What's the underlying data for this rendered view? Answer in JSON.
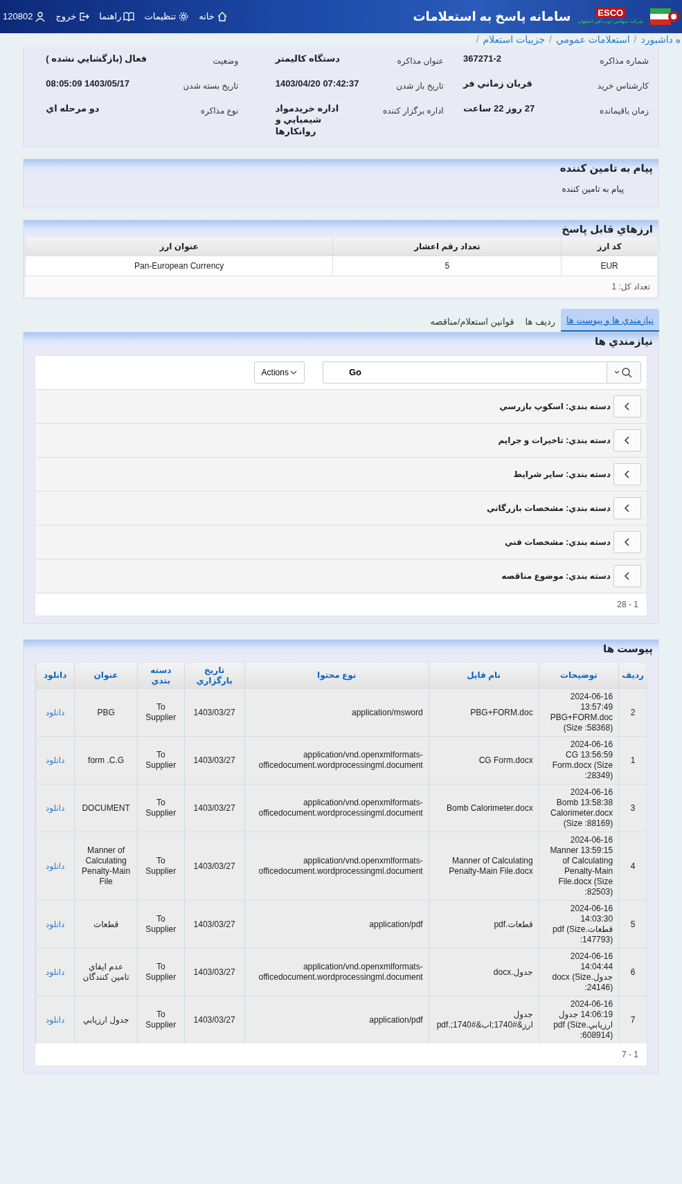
{
  "header": {
    "title": "سامانه پاسخ به استعلامات",
    "logo_text": "ESCO",
    "logo_subtitle": "شرکت سهامي ذوب آهن اصفهان",
    "nav": [
      {
        "label": "خانه",
        "kind": "home"
      },
      {
        "label": "تنظیمات",
        "kind": "settings"
      },
      {
        "label": "راهنما",
        "kind": "help"
      },
      {
        "label": "خروج",
        "kind": "logout"
      },
      {
        "label": "120802",
        "kind": "user"
      }
    ]
  },
  "breadcrumb": [
    "ه داشبورد",
    "استعلامات عمومي",
    "جزييات استعلام"
  ],
  "breadcrumb_separator": "/",
  "details": [
    {
      "label": "شماره مذاکره",
      "value": "367271-2"
    },
    {
      "label": "عنوان مذاکره",
      "value": "دستگاه کالیمتر"
    },
    {
      "label": "وضعيت",
      "value": "فعال (بازگشايي نشده )"
    },
    {
      "label": "کارشناس خرید",
      "value": "قربان زماني فر"
    },
    {
      "label": "تاریخ باز شدن",
      "value": "07:42:37 1403/04/20"
    },
    {
      "label": "تاريخ بسته شدن",
      "value": "1403/05/17 08:05:09"
    },
    {
      "label": "زمان باقیمانده",
      "value": "27 روز 22 ساعت"
    },
    {
      "label": "اداره برگزار کننده",
      "value": "اداره خريدمواد شيميايي و روانکارها"
    },
    {
      "label": "نوع مذاکره",
      "value": "دو مرحله اي"
    }
  ],
  "message": {
    "title": "پیام به تامین کننده",
    "body": "پیام به تامین کننده"
  },
  "currencies": {
    "title": "ارزهاي قابل پاسخ",
    "columns": [
      "کد ارز",
      "تعداد رقم اعشار",
      "عنوان ارز"
    ],
    "rows": [
      [
        "EUR",
        "5",
        "Pan-European Currency"
      ]
    ],
    "footer": "تعداد کل: 1"
  },
  "tabs": [
    {
      "label": "نیازمندي ها و پیوست ها",
      "selected": true
    },
    {
      "label": "ردیف ها",
      "selected": false
    },
    {
      "label": "قوانين استعلام/مناقصه",
      "selected": false
    }
  ],
  "needs": {
    "title": "نیازمندي ها",
    "go": "Go",
    "actions": "Actions",
    "groups": [
      {
        "label": "دسته بندي: اسکوپ بازرسي",
        "expanded": false
      },
      {
        "label": "دسته بندي: تاخيرات و جرايم",
        "expanded": false
      },
      {
        "label": "دسته بندي: ساير شرايط",
        "expanded": false
      },
      {
        "label": "دسته بندي: مشخصات بازرگاني",
        "expanded": false
      },
      {
        "label": "دسته بندي: مشخصات فني",
        "expanded": false
      },
      {
        "label": "دسته بندي: موضوع مناقصه",
        "expanded": false
      }
    ],
    "pagination": "1 - 28"
  },
  "attachments": {
    "title": "پیوست ها",
    "columns": [
      "ردیف",
      "توضیحات",
      "نام فایل",
      "نوع محتوا",
      "تاریخ بارگزاري",
      "دسته بندي",
      "عنوان",
      "دانلود"
    ],
    "rows": [
      [
        "2",
        "2024-06-16 13:57:49 PBG+FORM.doc (Size :58368)",
        "PBG+FORM.doc",
        "application/msword",
        "1403/03/27",
        "To Supplier",
        "PBG",
        "دانلود"
      ],
      [
        "1",
        "2024-06-16 13:56:59 CG Form.docx (Size :28349)",
        "CG Form.docx",
        "application/vnd.openxmlformats-officedocument.wordprocessingml.document",
        "1403/03/27",
        "To Supplier",
        "form .C.G",
        "دانلود"
      ],
      [
        "3",
        "2024-06-16 13:58:38 Bomb Calorimeter.docx (Size :88169)",
        "Bomb Calorimeter.docx",
        "application/vnd.openxmlformats-officedocument.wordprocessingml.document",
        "1403/03/27",
        "To Supplier",
        "DOCUMENT",
        "دانلود"
      ],
      [
        "4",
        "2024-06-16 13:59:15 Manner of Calculating Penalty-Main File.docx (Size :82503)",
        "Manner of Calculating Penalty-Main File.docx",
        "application/vnd.openxmlformats-officedocument.wordprocessingml.document",
        "1403/03/27",
        "To Supplier",
        "Manner of Calculating Penalty-Main File",
        "دانلود"
      ],
      [
        "5",
        "2024-06-16 14:03:30 قطعات.pdf (Size :147793)",
        "قطعات.pdf",
        "application/pdf",
        "1403/03/27",
        "To Supplier",
        "قطعات",
        "دانلود"
      ],
      [
        "6",
        "2024-06-16 14:04:44 جدول.docx (Size :24146)",
        "جدول.docx",
        "application/vnd.openxmlformats-officedocument.wordprocessingml.document",
        "1403/03/27",
        "To Supplier",
        "عدم ايفاي تامين کنندگان",
        "دانلود"
      ],
      [
        "7",
        "2024-06-16 14:06:19 جدول ارزيابي.pdf (Size :608914)",
        "جدول ارز&#1740;اب&#1740;.pdf",
        "application/pdf",
        "1403/03/27",
        "To Supplier",
        "جدول ارزيابي",
        "دانلود"
      ]
    ],
    "pagination": "1 - 7"
  }
}
